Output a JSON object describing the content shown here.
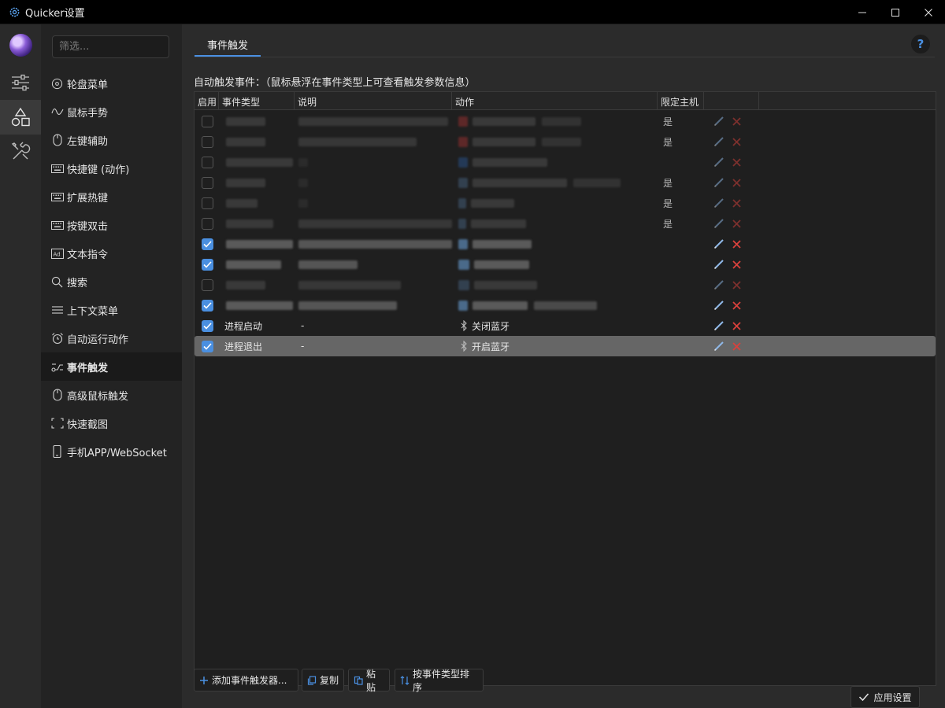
{
  "window": {
    "title": "Quicker设置",
    "minimize_icon": "minimize-icon",
    "maximize_icon": "maximize-icon",
    "close_icon": "close-icon"
  },
  "sidebar": {
    "filter_placeholder": "筛选...",
    "items": [
      {
        "label": "轮盘菜单",
        "icon": "circle-menu-icon"
      },
      {
        "label": "鼠标手势",
        "icon": "gesture-icon"
      },
      {
        "label": "左键辅助",
        "icon": "mouse-icon"
      },
      {
        "label": "快捷键 (动作)",
        "icon": "keyboard-icon"
      },
      {
        "label": "扩展热键",
        "icon": "keyboard-icon"
      },
      {
        "label": "按键双击",
        "icon": "keyboard-icon"
      },
      {
        "label": "文本指令",
        "icon": "ad-text-icon"
      },
      {
        "label": "搜索",
        "icon": "search-icon"
      },
      {
        "label": "上下文菜单",
        "icon": "menu-lines-icon"
      },
      {
        "label": "自动运行动作",
        "icon": "alarm-icon"
      },
      {
        "label": "事件触发",
        "icon": "event-icon"
      },
      {
        "label": "高级鼠标触发",
        "icon": "mouse-icon"
      },
      {
        "label": "快速截图",
        "icon": "screenshot-icon"
      },
      {
        "label": "手机APP/WebSocket",
        "icon": "phone-icon"
      }
    ],
    "active_index": 10
  },
  "main": {
    "tab": "事件触发",
    "help": "?",
    "description": "自动触发事件：（鼠标悬浮在事件类型上可查看触发参数信息）",
    "columns": [
      "启用",
      "事件类型",
      "说明",
      "动作",
      "限定主机",
      ""
    ],
    "rows": [
      {
        "enabled": false,
        "type": "",
        "note": "",
        "action": "",
        "host": "是",
        "redacted": true,
        "dim": true
      },
      {
        "enabled": false,
        "type": "",
        "note": "",
        "action": "",
        "host": "是",
        "redacted": true,
        "dim": true
      },
      {
        "enabled": false,
        "type": "",
        "note": "",
        "action": "",
        "host": "",
        "redacted": true,
        "dim": true
      },
      {
        "enabled": false,
        "type": "",
        "note": "",
        "action": "",
        "host": "是",
        "redacted": true,
        "dim": true
      },
      {
        "enabled": false,
        "type": "",
        "note": "",
        "action": "",
        "host": "是",
        "redacted": true,
        "dim": true
      },
      {
        "enabled": false,
        "type": "",
        "note": "",
        "action": "",
        "host": "是",
        "redacted": true,
        "dim": true
      },
      {
        "enabled": true,
        "type": "",
        "note": "",
        "action": "",
        "host": "",
        "redacted": true,
        "dim": false
      },
      {
        "enabled": true,
        "type": "",
        "note": "",
        "action": "",
        "host": "",
        "redacted": true,
        "dim": false
      },
      {
        "enabled": false,
        "type": "",
        "note": "",
        "action": "",
        "host": "",
        "redacted": true,
        "dim": true
      },
      {
        "enabled": true,
        "type": "",
        "note": "",
        "action": "",
        "host": "",
        "redacted": true,
        "dim": false
      },
      {
        "enabled": true,
        "type": "进程启动",
        "note": "-",
        "action": "关闭蓝牙",
        "action_icon": "bluetooth-icon",
        "host": "",
        "redacted": false,
        "dim": false
      },
      {
        "enabled": true,
        "type": "进程退出",
        "note": "-",
        "action": "开启蓝牙",
        "action_icon": "bluetooth-icon",
        "host": "",
        "redacted": false,
        "dim": false,
        "selected": true
      }
    ]
  },
  "buttons": {
    "add": "添加事件触发器...",
    "copy": "复制",
    "paste": "粘贴",
    "sort": "按事件类型排序",
    "apply": "应用设置"
  },
  "colors": {
    "accent": "#4a8fe0",
    "delete": "#d9413c",
    "selected_row": "#666666"
  }
}
